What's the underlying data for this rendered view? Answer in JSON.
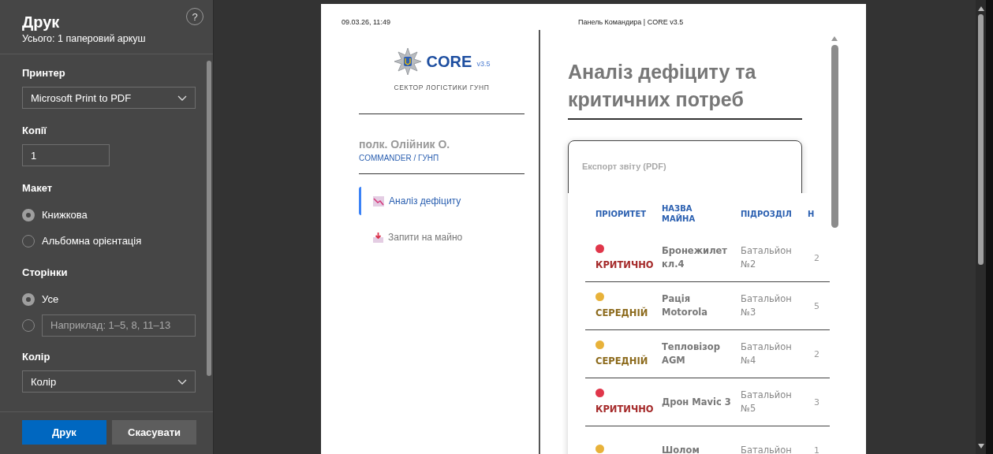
{
  "dialog": {
    "title": "Друк",
    "summary": "Усього: 1 паперовий аркуш",
    "help": "?",
    "printer": {
      "label": "Принтер",
      "value": "Microsoft Print to PDF"
    },
    "copies": {
      "label": "Копії",
      "value": "1"
    },
    "layout": {
      "label": "Макет",
      "options": [
        {
          "label": "Книжкова",
          "selected": true
        },
        {
          "label": "Альбомна орієнтація",
          "selected": false
        }
      ]
    },
    "pages": {
      "label": "Сторінки",
      "options": [
        {
          "kind": "text",
          "label": "Усе",
          "selected": true
        },
        {
          "kind": "field",
          "placeholder": "Наприклад: 1–5, 8, 11–13",
          "selected": false
        }
      ]
    },
    "color": {
      "label": "Колір",
      "value": "Колір"
    },
    "buttons": [
      {
        "label": "Друк",
        "kind": "primary"
      },
      {
        "label": "Скасувати",
        "kind": "secondary"
      }
    ]
  },
  "preview": {
    "header_left": "09.03.26, 11:49",
    "header_center": "Панель Командира | CORE v3.5",
    "brand": {
      "name": "CORE",
      "version": "v3.5",
      "subtitle": "СЕКТОР ЛОГІСТИКИ ГУНП"
    },
    "user": {
      "name": "полк. Олійник О.",
      "role": "COMMANDER / ГУНП"
    },
    "nav": [
      {
        "label": "Аналіз дефіциту",
        "selected": true,
        "kind": "chart"
      },
      {
        "label": "Запити на майно",
        "selected": false,
        "kind": "inbox"
      }
    ],
    "title": "Аналіз дефіциту та критичних потреб",
    "export": "Експорт звіту (PDF)",
    "table": {
      "columns": [
        "ПРІОРИТЕТ",
        "НАЗВА МАЙНА",
        "ПІДРОЗДІЛ",
        "Н"
      ],
      "rows": [
        {
          "priority": "КРИТИЧНО",
          "kind": "critical",
          "color": "#e0364a",
          "name": "Бронежилет кл.4",
          "unit": "Батальйон №2",
          "column_4": "2"
        },
        {
          "priority": "СЕРЕДНІЙ",
          "kind": "medium",
          "color": "#e8b23a",
          "name": "Рація Motorola",
          "unit": "Батальйон №3",
          "column_4": "5"
        },
        {
          "priority": "СЕРЕДНІЙ",
          "kind": "medium",
          "color": "#e8b23a",
          "name": "Тепловізор AGM",
          "unit": "Батальйон №4",
          "column_4": "2"
        },
        {
          "priority": "КРИТИЧНО",
          "kind": "critical",
          "color": "#e0364a",
          "name": "Дрон Mavic 3",
          "unit": "Батальйон №5",
          "column_4": "3"
        },
        {
          "color": "#e8b23a",
          "name": "Шолом",
          "unit": "Батальйон",
          "column_4": "1"
        }
      ]
    }
  }
}
